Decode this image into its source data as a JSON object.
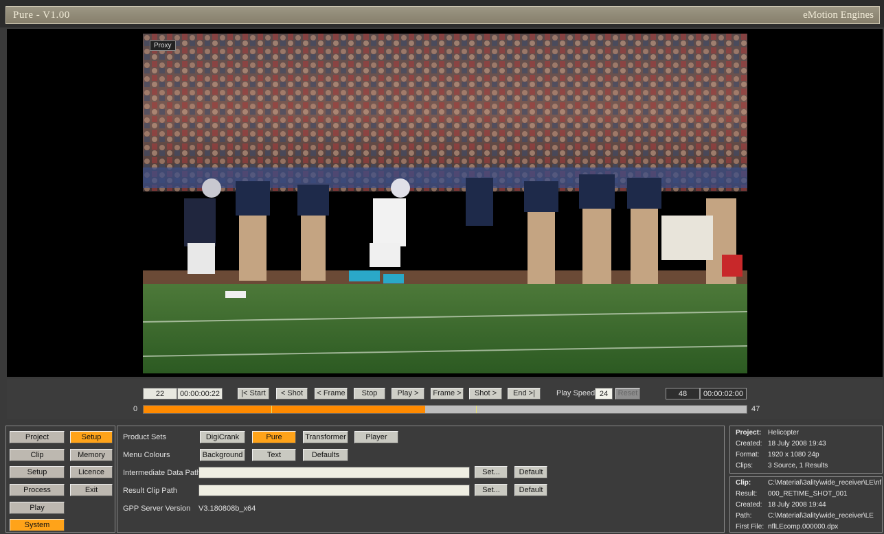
{
  "window": {
    "title": "Pure - V1.00",
    "brand": "eMotion Engines"
  },
  "viewer": {
    "proxy_label": "Proxy"
  },
  "transport": {
    "current_frame": "22",
    "current_tc": "00:00:00:22",
    "buttons": [
      "|< Start",
      "< Shot",
      "< Frame",
      "Stop",
      "Play >",
      "Frame >",
      "Shot >",
      "End >|"
    ],
    "play_speed_label": "Play Speed",
    "play_speed": "24",
    "reset_label": "Reset",
    "end_frame": "48",
    "end_tc": "00:00:02:00",
    "range_start": "0",
    "range_end": "47",
    "progress": 0.467
  },
  "nav": {
    "left": [
      "Project",
      "Clip",
      "Setup",
      "Process",
      "Play",
      "System"
    ],
    "right": [
      "Setup",
      "Memory",
      "Licence",
      "Exit"
    ]
  },
  "settings": {
    "product_sets_label": "Product Sets",
    "product_sets": [
      "DigiCrank",
      "Pure",
      "Transformer",
      "Player"
    ],
    "menu_colours_label": "Menu Colours",
    "menu_colours": [
      "Background",
      "Text",
      "Defaults"
    ],
    "intermediate_label": "Intermediate Data Path",
    "intermediate_value": "",
    "result_label": "Result Clip Path",
    "result_value": "",
    "set_label": "Set...",
    "default_label": "Default",
    "gpp_label": "GPP Server Version",
    "gpp_value": "V3.180808b_x64"
  },
  "project_info": {
    "project_key": "Project:",
    "project_val": "Helicopter",
    "created_key": "Created:",
    "created_val": "18 July 2008     19:43",
    "format_key": "Format:",
    "format_val": "1920 x 1080  24p",
    "clips_key": "Clips:",
    "clips_val": "3 Source,   1 Results"
  },
  "clip_info": {
    "clip_key": "Clip:",
    "clip_val": "C:\\Material\\3ality\\wide_receiver\\LE\\nf",
    "result_key": "Result:",
    "result_val": "000_RETIME_SHOT_001",
    "created_key": "Created:",
    "created_val": "18 July 2008     19:44",
    "path_key": "Path:",
    "path_val": "C:\\Material\\3ality\\wide_receiver\\LE",
    "first_key": "First File:",
    "first_val": "nflLEcomp.000000.dpx"
  },
  "colors": {
    "accent": "#ffa319",
    "timeline": "#ff8a00"
  }
}
